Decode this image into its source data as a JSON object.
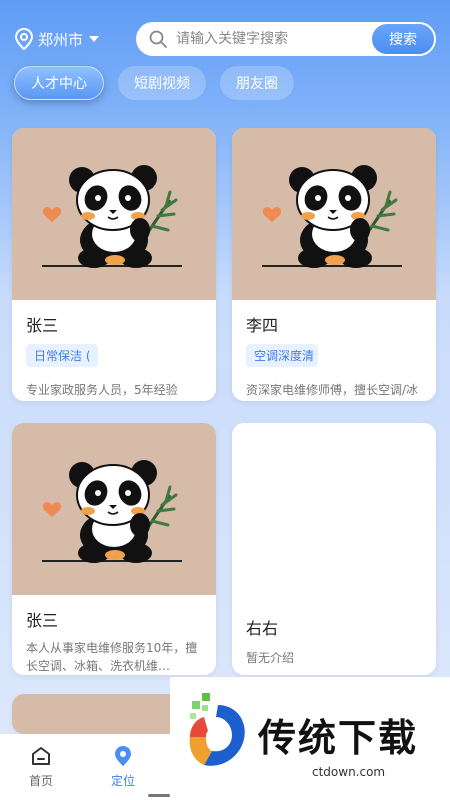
{
  "header": {
    "city": "郑州市",
    "search_placeholder": "请输入关键字搜索",
    "search_button": "搜索"
  },
  "tabs": [
    {
      "label": "人才中心",
      "active": true
    },
    {
      "label": "短剧视频",
      "active": false
    },
    {
      "label": "朋友圈",
      "active": false
    }
  ],
  "cards": [
    {
      "name": "张三",
      "tag": "日常保洁 (",
      "desc": "专业家政服务人员，5年经验",
      "image": "panda-illustration"
    },
    {
      "name": "李四",
      "tag": "空调深度清",
      "desc": "资深家电维修师傅，擅长空调/冰箱",
      "image": "panda-illustration"
    },
    {
      "name": "张三",
      "desc": "本人从事家电维修服务10年，擅长空调、冰箱、洗衣机维…",
      "image": "panda-illustration"
    },
    {
      "name": "右右",
      "desc": "暂无介绍"
    }
  ],
  "bottom_nav": [
    {
      "label": "首页",
      "icon": "home-icon",
      "active": false
    },
    {
      "label": "定位",
      "icon": "location-icon",
      "active": true
    }
  ],
  "watermark": {
    "brand": "传统下载",
    "site": "ctdown.com"
  },
  "colors": {
    "accent": "#4c8ef3",
    "card_image_bg": "#d6bba8"
  }
}
